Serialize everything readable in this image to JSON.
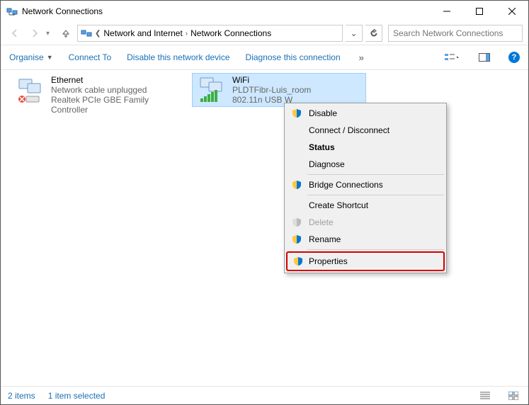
{
  "window": {
    "title": "Network Connections"
  },
  "breadcrumb": {
    "a": "Network and Internet",
    "b": "Network Connections"
  },
  "search": {
    "placeholder": "Search Network Connections"
  },
  "commands": {
    "organise": "Organise",
    "connect": "Connect To",
    "disable": "Disable this network device",
    "diagnose": "Diagnose this connection",
    "overflow": "»"
  },
  "adapters": {
    "ethernet": {
      "name": "Ethernet",
      "status": "Network cable unplugged",
      "device": "Realtek PCIe GBE Family Controller"
    },
    "wifi": {
      "name": "WiFi",
      "status": "PLDTFibr-Luis_room",
      "device": "802.11n USB W"
    }
  },
  "context_menu": {
    "disable": "Disable",
    "connect": "Connect / Disconnect",
    "status": "Status",
    "diagnose": "Diagnose",
    "bridge": "Bridge Connections",
    "shortcut": "Create Shortcut",
    "delete": "Delete",
    "rename": "Rename",
    "properties": "Properties"
  },
  "status_bar": {
    "count": "2 items",
    "selected": "1 item selected"
  }
}
